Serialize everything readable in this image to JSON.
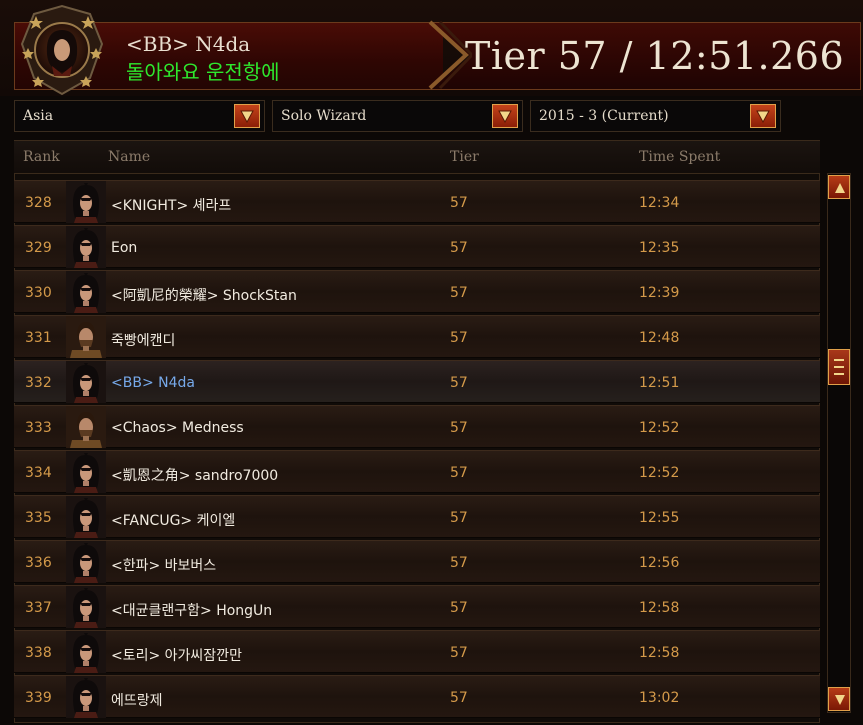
{
  "player": {
    "guild_tag": "<BB>",
    "name": "N4da",
    "motto": "돌아와요 운전항에"
  },
  "result": {
    "tier_time": "Tier 57 / 12:51.266"
  },
  "filters": {
    "region": "Asia",
    "category": "Solo Wizard",
    "season": "2015 - 3 (Current)"
  },
  "table": {
    "headers": {
      "rank": "Rank",
      "name": "Name",
      "tier": "Tier",
      "time": "Time Spent"
    },
    "rows": [
      {
        "rank": "328",
        "name": "<KNIGHT> 셰라프",
        "tier": "57",
        "time": "12:34",
        "gender": "female"
      },
      {
        "rank": "329",
        "name": "Eon",
        "tier": "57",
        "time": "12:35",
        "gender": "female"
      },
      {
        "rank": "330",
        "name": "<阿凱尼的榮耀> ShockStan",
        "tier": "57",
        "time": "12:39",
        "gender": "female"
      },
      {
        "rank": "331",
        "name": "죽빵에캔디",
        "tier": "57",
        "time": "12:48",
        "gender": "male"
      },
      {
        "rank": "332",
        "name": "<BB> N4da",
        "tier": "57",
        "time": "12:51",
        "gender": "female",
        "highlight": true
      },
      {
        "rank": "333",
        "name": "<Chaos> Medness",
        "tier": "57",
        "time": "12:52",
        "gender": "male"
      },
      {
        "rank": "334",
        "name": "<凱恩之角> sandro7000",
        "tier": "57",
        "time": "12:52",
        "gender": "female"
      },
      {
        "rank": "335",
        "name": "<FANCUG> 케이엘",
        "tier": "57",
        "time": "12:55",
        "gender": "female"
      },
      {
        "rank": "336",
        "name": "<한파> 바보버스",
        "tier": "57",
        "time": "12:56",
        "gender": "female"
      },
      {
        "rank": "337",
        "name": "<대균클랜구함> HongUn",
        "tier": "57",
        "time": "12:58",
        "gender": "female"
      },
      {
        "rank": "338",
        "name": "<토리> 아가씨잠깐만",
        "tier": "57",
        "time": "12:58",
        "gender": "female"
      },
      {
        "rank": "339",
        "name": "에뜨랑제",
        "tier": "57",
        "time": "13:02",
        "gender": "female"
      }
    ]
  },
  "icons": {
    "emblem": "crest-icon",
    "dropdown_arrow": "chevron-down-icon",
    "scroll_up": "arrow-up-icon",
    "scroll_down": "arrow-down-icon",
    "scroll_thumb": "grip-icon"
  },
  "colors": {
    "accent_orange": "#d49a4a",
    "motto_green": "#2ee82e",
    "highlight_name": "#77a9ea",
    "panel_red": "#4a0c06"
  }
}
